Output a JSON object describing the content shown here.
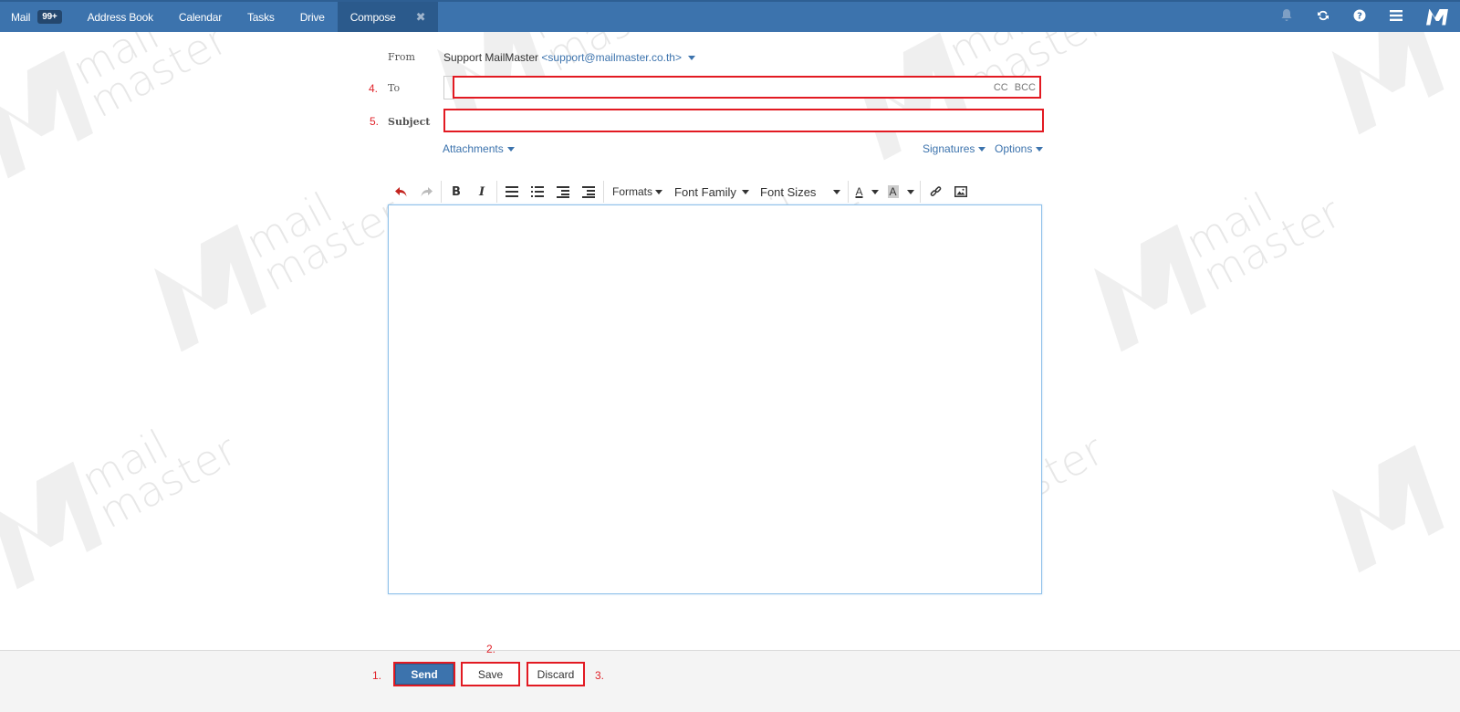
{
  "nav": {
    "items": [
      {
        "label": "Mail",
        "badge": "99+"
      },
      {
        "label": "Address Book"
      },
      {
        "label": "Calendar"
      },
      {
        "label": "Tasks"
      },
      {
        "label": "Drive"
      },
      {
        "label": "Compose",
        "active": true
      }
    ],
    "close_glyph": "✖",
    "right_icons": [
      "bell-icon",
      "refresh-icon",
      "help-icon",
      "menu-icon",
      "mailmaster-logo-icon"
    ]
  },
  "watermark": {
    "line1": "mail",
    "line2": "master"
  },
  "compose": {
    "from_label": "From",
    "from_name": "Support MailMaster",
    "from_address": "<support@mailmaster.co.th>",
    "to_label": "To",
    "to_value": "",
    "cc_label": "CC",
    "bcc_label": "BCC",
    "subject_label": "Subject",
    "subject_value": "",
    "attachments_label": "Attachments",
    "signatures_label": "Signatures",
    "options_label": "Options",
    "body_value": ""
  },
  "toolbar": {
    "bold": "B",
    "italic": "I",
    "formats": "Formats",
    "font_family": "Font Family",
    "font_sizes": "Font Sizes",
    "text_color": "A",
    "bg_color": "A"
  },
  "footer": {
    "send": "Send",
    "save": "Save",
    "discard": "Discard"
  },
  "annotations": {
    "n1": "1.",
    "n2": "2.",
    "n3": "3.",
    "n4": "4.",
    "n5": "5."
  },
  "colors": {
    "topbar": "#3c73ad",
    "active_tab": "#2b5a8c",
    "link": "#3c73ad",
    "annotation_red": "#e21a22"
  }
}
